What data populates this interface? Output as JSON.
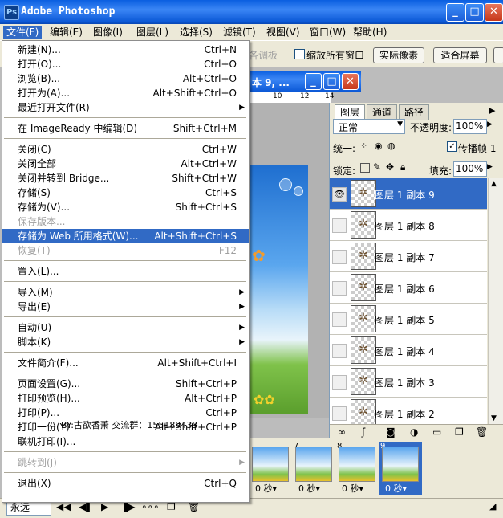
{
  "window": {
    "title": "Adobe Photoshop",
    "app_icon": "Ps",
    "buttons": [
      "_",
      "□",
      "✕"
    ]
  },
  "menubar": [
    "文件(F)",
    "编辑(E)",
    "图像(I)",
    "图层(L)",
    "选择(S)",
    "滤镜(T)",
    "视图(V)",
    "窗口(W)",
    "帮助(H)"
  ],
  "options": {
    "faded_label": "各调板",
    "checkbox_label": "缩放所有窗口",
    "btn_actual": "实际像素",
    "btn_fit": "适合屏幕"
  },
  "document": {
    "title": "本 9, ..."
  },
  "ruler_ticks": [
    "10",
    "12",
    "14"
  ],
  "file_menu": [
    {
      "label": "新建(N)...",
      "shortcut": "Ctrl+N"
    },
    {
      "label": "打开(O)...",
      "shortcut": "Ctrl+O"
    },
    {
      "label": "浏览(B)...",
      "shortcut": "Alt+Ctrl+O"
    },
    {
      "label": "打开为(A)...",
      "shortcut": "Alt+Shift+Ctrl+O"
    },
    {
      "label": "最近打开文件(R)",
      "shortcut": "",
      "submenu": true
    },
    {
      "sep": true
    },
    {
      "label": "在 ImageReady 中编辑(D)",
      "shortcut": "Shift+Ctrl+M"
    },
    {
      "sep": true
    },
    {
      "label": "关闭(C)",
      "shortcut": "Ctrl+W"
    },
    {
      "label": "关闭全部",
      "shortcut": "Alt+Ctrl+W"
    },
    {
      "label": "关闭并转到 Bridge...",
      "shortcut": "Shift+Ctrl+W"
    },
    {
      "label": "存储(S)",
      "shortcut": "Ctrl+S"
    },
    {
      "label": "存储为(V)...",
      "shortcut": "Shift+Ctrl+S"
    },
    {
      "label": "保存版本...",
      "shortcut": "",
      "disabled": true
    },
    {
      "label": "存储为 Web 所用格式(W)...",
      "shortcut": "Alt+Shift+Ctrl+S",
      "highlight": true
    },
    {
      "label": "恢复(T)",
      "shortcut": "F12",
      "disabled": true
    },
    {
      "sep": true
    },
    {
      "label": "置入(L)...",
      "shortcut": ""
    },
    {
      "sep": true
    },
    {
      "label": "导入(M)",
      "shortcut": "",
      "submenu": true
    },
    {
      "label": "导出(E)",
      "shortcut": "",
      "submenu": true
    },
    {
      "sep": true
    },
    {
      "label": "自动(U)",
      "shortcut": "",
      "submenu": true
    },
    {
      "label": "脚本(K)",
      "shortcut": "",
      "submenu": true
    },
    {
      "sep": true
    },
    {
      "label": "文件简介(F)...",
      "shortcut": "Alt+Shift+Ctrl+I"
    },
    {
      "sep": true
    },
    {
      "label": "页面设置(G)...",
      "shortcut": "Shift+Ctrl+P"
    },
    {
      "label": "打印预览(H)...",
      "shortcut": "Alt+Ctrl+P"
    },
    {
      "label": "打印(P)...",
      "shortcut": "Ctrl+P"
    },
    {
      "label": "打印一份(Y)",
      "shortcut": "Alt+Shift+Ctrl+P"
    },
    {
      "label": "联机打印(I)...",
      "shortcut": ""
    },
    {
      "sep": true
    },
    {
      "label": "跳转到(J)",
      "shortcut": "",
      "submenu": true,
      "disabled": true
    },
    {
      "sep": true
    },
    {
      "label": "退出(X)",
      "shortcut": "Ctrl+Q"
    }
  ],
  "watermark": "BY:古欲香萧 交流群：155189433",
  "layers_panel": {
    "tabs": [
      "图层",
      "通道",
      "路径"
    ],
    "blend_mode": "正常",
    "opacity_label": "不透明度:",
    "opacity_value": "100%",
    "unify_label": "统一:",
    "propagate_label": "传播帧 1",
    "lock_label": "锁定:",
    "fill_label": "填充:",
    "fill_value": "100%",
    "layers": [
      "图层 1 副本 9",
      "图层 1 副本 8",
      "图层 1 副本 7",
      "图层 1 副本 6",
      "图层 1 副本 5",
      "图层 1 副本 4",
      "图层 1 副本 3",
      "图层 1 副本 2"
    ],
    "selected_index": 0
  },
  "animation": {
    "frames": [
      {
        "num": "",
        "time": "0 秒▾"
      },
      {
        "num": "7",
        "time": "0 秒▾"
      },
      {
        "num": "8",
        "time": "0 秒▾"
      },
      {
        "num": "9",
        "time": "0 秒▾"
      }
    ],
    "selected_index": 3,
    "loop_label": "永远"
  }
}
